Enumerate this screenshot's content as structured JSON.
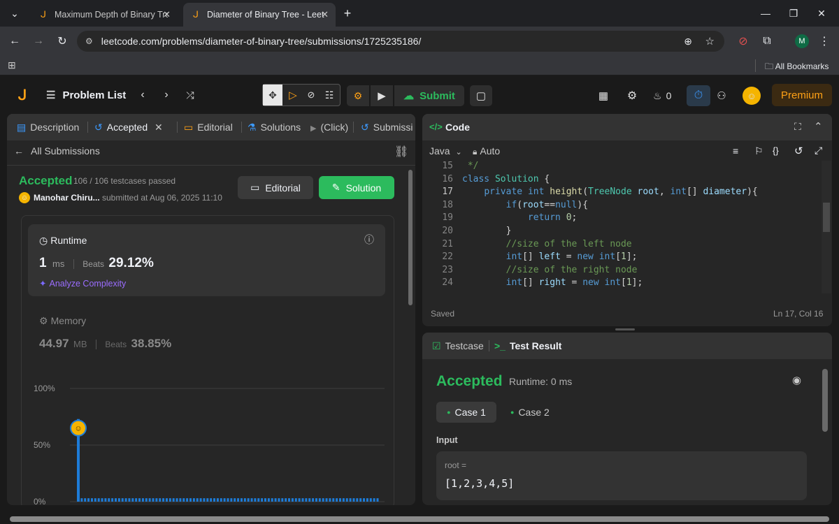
{
  "browser": {
    "tabs": [
      {
        "title": "Maximum Depth of Binary Tree"
      },
      {
        "title": "Diameter of Binary Tree - LeetC"
      }
    ],
    "url": "leetcode.com/problems/diameter-of-binary-tree/submissions/1725235186/",
    "profile_initial": "M",
    "all_bookmarks": "All Bookmarks"
  },
  "header": {
    "problem_list": "Problem List",
    "submit": "Submit",
    "streak": "0",
    "premium": "Premium"
  },
  "left_tabs": [
    {
      "label": "Description"
    },
    {
      "label": "Accepted"
    },
    {
      "label": "Editorial"
    },
    {
      "label": "Solutions"
    },
    {
      "label": "(Click)"
    },
    {
      "label": "Submissi"
    }
  ],
  "submission": {
    "back_label": "All Submissions",
    "status": "Accepted",
    "testcases": "106 / 106 testcases passed",
    "user": "Manohar Chiru...",
    "submitted_at": "submitted at Aug 06, 2025 11:10",
    "editorial_btn": "Editorial",
    "solution_btn": "Solution",
    "runtime": {
      "label": "Runtime",
      "value": "1",
      "unit": "ms",
      "beats_label": "Beats",
      "beats": "29.12%",
      "analyze": "Analyze Complexity"
    },
    "memory": {
      "label": "Memory",
      "value": "44.97",
      "unit": "MB",
      "beats_label": "Beats",
      "beats": "38.85%"
    }
  },
  "chart_data": {
    "type": "bar",
    "yticks": [
      "100%",
      "50%",
      "0%"
    ],
    "ylim": [
      0,
      100
    ],
    "values": [
      73,
      3,
      3,
      3,
      3,
      3,
      3,
      3,
      3,
      3,
      3,
      3,
      3,
      3,
      3,
      3,
      3,
      3,
      3,
      3,
      3,
      3,
      3,
      3,
      3,
      3,
      3,
      3,
      3,
      3,
      3,
      3,
      3,
      3,
      3,
      3,
      3,
      3,
      3,
      3,
      3,
      3,
      3,
      3,
      3,
      3,
      3,
      3,
      3,
      3,
      3,
      3,
      3,
      3,
      3,
      3,
      3,
      3,
      3,
      3,
      3,
      3,
      3,
      3,
      3,
      3,
      3,
      3,
      3,
      3,
      3,
      3,
      3,
      3,
      3,
      3,
      3,
      3,
      3,
      3,
      3,
      3,
      3,
      3,
      3,
      3,
      3,
      3,
      3
    ],
    "marker_index": 0,
    "color": "#1d7cd8"
  },
  "code": {
    "title": "Code",
    "language": "Java",
    "mode": "Auto",
    "saved": "Saved",
    "cursor": "Ln 17, Col 16",
    "lines": [
      {
        "n": "15",
        "t": " */"
      },
      {
        "n": "16",
        "t": "class Solution {"
      },
      {
        "n": "17",
        "t": "    private int height(TreeNode root, int[] diameter){"
      },
      {
        "n": "18",
        "t": "        if(root==null){"
      },
      {
        "n": "19",
        "t": "            return 0;"
      },
      {
        "n": "20",
        "t": "        }"
      },
      {
        "n": "21",
        "t": "        //size of the left node"
      },
      {
        "n": "22",
        "t": "        int[] left = new int[1];"
      },
      {
        "n": "23",
        "t": "        //size of the right node"
      },
      {
        "n": "24",
        "t": "        int[] right = new int[1];"
      }
    ]
  },
  "result": {
    "testcase_tab": "Testcase",
    "result_tab": "Test Result",
    "status": "Accepted",
    "runtime": "Runtime: 0 ms",
    "cases": [
      "Case 1",
      "Case 2"
    ],
    "input_label": "Input",
    "var_label": "root =",
    "var_value": "[1,2,3,4,5]"
  },
  "colors": {
    "accent_green": "#2cbb5d",
    "brand_orange": "#ffa116",
    "premium_bg": "#3b2a12",
    "chart_blue": "#1d7cd8"
  }
}
